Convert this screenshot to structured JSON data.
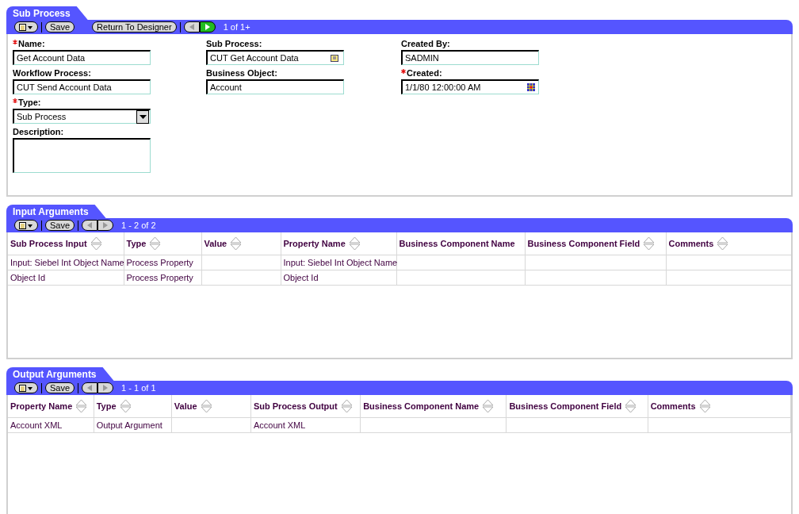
{
  "form": {
    "title": "Sub Process",
    "toolbar": {
      "buttons": [
        {
          "label": "Save"
        },
        {
          "label": "Return To Designer"
        }
      ],
      "prev_disabled": true,
      "next_disabled": false,
      "record_count": "1 of 1+"
    },
    "columns": [
      [
        {
          "label": "Name:",
          "required": true,
          "kind": "text",
          "value": "Get Account Data"
        },
        {
          "label": "Workflow Process:",
          "required": false,
          "kind": "text",
          "value": "CUT Send Account Data"
        },
        {
          "label": "Type:",
          "required": true,
          "kind": "select",
          "value": "Sub Process"
        },
        {
          "label": "Description:",
          "required": false,
          "kind": "textarea"
        }
      ],
      [
        {
          "label": "Sub Process:",
          "required": false,
          "kind": "pick",
          "value": "CUT Get Account Data"
        },
        {
          "label": "Business Object:",
          "required": false,
          "kind": "text",
          "value": "Account"
        }
      ],
      [
        {
          "label": "Created By:",
          "required": false,
          "kind": "text",
          "value": "SADMIN"
        },
        {
          "label": "Created:",
          "required": true,
          "kind": "date",
          "value": "1/1/80 12:00:00 AM"
        }
      ]
    ]
  },
  "lists": [
    {
      "title": "Input Arguments",
      "toolbar": {
        "buttons": [
          {
            "label": "Save"
          }
        ],
        "prev_disabled": true,
        "next_disabled": true,
        "record_count": "1 - 2 of 2"
      },
      "columns": [
        {
          "label": "Sub Process Input",
          "sortable": true
        },
        {
          "label": "Type",
          "sortable": true
        },
        {
          "label": "Value",
          "sortable": true
        },
        {
          "label": "Property Name",
          "sortable": true
        },
        {
          "label": "Business Component Name",
          "sortable": false
        },
        {
          "label": "Business Component Field",
          "sortable": true
        },
        {
          "label": "Comments",
          "sortable": true
        }
      ],
      "rows": [
        [
          "Input: Siebel Int Object Name",
          "Process Property",
          "",
          "Input: Siebel Int Object Name",
          "",
          "",
          ""
        ],
        [
          "Object Id",
          "Process Property",
          "",
          "Object Id",
          "",
          "",
          ""
        ]
      ]
    },
    {
      "title": "Output Arguments",
      "toolbar": {
        "buttons": [
          {
            "label": "Save"
          }
        ],
        "prev_disabled": true,
        "next_disabled": true,
        "record_count": "1 - 1 of 1"
      },
      "columns": [
        {
          "label": "Property Name",
          "sortable": true
        },
        {
          "label": "Type",
          "sortable": true
        },
        {
          "label": "Value",
          "sortable": true
        },
        {
          "label": "Sub Process Output",
          "sortable": true
        },
        {
          "label": "Business Component Name",
          "sortable": true
        },
        {
          "label": "Business Component Field",
          "sortable": true
        },
        {
          "label": "Comments",
          "sortable": true
        }
      ],
      "rows": [
        [
          "Account XML",
          "Output Argument",
          "",
          "Account XML",
          "",
          "",
          ""
        ]
      ]
    }
  ]
}
